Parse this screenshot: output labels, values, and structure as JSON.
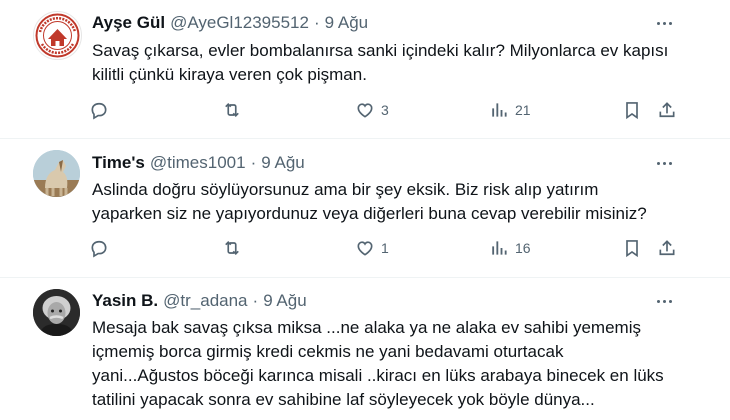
{
  "tweets": [
    {
      "name": "Ayşe Gül",
      "handle": "@AyeGl12395512",
      "separator": "·",
      "time": "9 Ağu",
      "text_lines": [
        "Savaş çıkarsa, evler bombalanırsa sanki içindeki kalır? Milyonlarca ev kapısı",
        "kilitli çünkü kiraya veren çok pişman."
      ],
      "likes": "3",
      "views": "21",
      "avatar": "logo-avatar",
      "avatar_logo_text": "KİRA SAHİPLERİ DERNEĞİ"
    },
    {
      "name": "Time's",
      "handle": "@times1001",
      "separator": "·",
      "time": "9 Ağu",
      "text_lines": [
        "Aslinda doğru söylüyorsunuz ama bir şey eksik. Biz risk alıp yatırım",
        "yaparken siz ne yapıyordunuz veya diğerleri buna cevap verebilir misiniz?"
      ],
      "likes": "1",
      "views": "16",
      "avatar": "horse-photo-avatar"
    },
    {
      "name": "Yasin B.",
      "handle": "@tr_adana",
      "separator": "·",
      "time": "9 Ağu",
      "text_lines": [
        "Mesaja bak savaş çıksa miksa ...ne alaka ya ne alaka ev sahibi yememiş",
        "içmemiş borca girmiş kredi cekmis ne yani bedavami oturtacak",
        "yani...Ağustos böceği karınca misali ..kiracı en lüks arabaya binecek en lüks",
        "tatilini yapacak sonra ev sahibine laf söyleyecek yok böyle dünya..."
      ],
      "avatar": "portrait-photo-avatar"
    }
  ],
  "colors": {
    "text": "#0f1419",
    "secondary": "#536471",
    "divider": "#eff3f4"
  },
  "icons": [
    "reply-icon",
    "retweet-icon",
    "like-icon",
    "views-icon",
    "bookmark-icon",
    "share-icon",
    "more-icon"
  ]
}
